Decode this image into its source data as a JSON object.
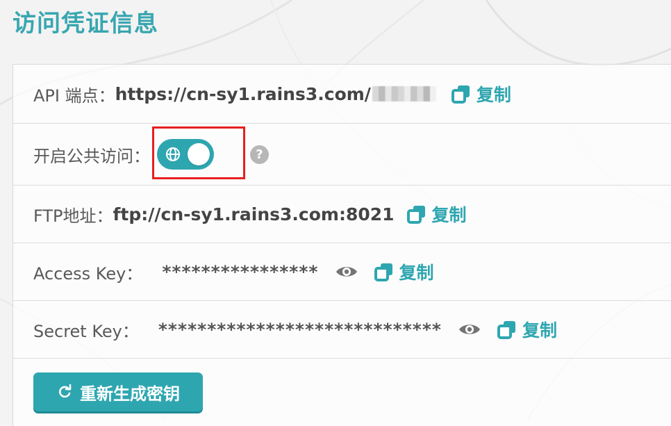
{
  "page": {
    "title": "访问凭证信息"
  },
  "api": {
    "label": "API 端点：",
    "value": "https://cn-sy1.rains3.com/",
    "copy_label": "复制"
  },
  "public_access": {
    "label": "开启公共访问："
  },
  "ftp": {
    "label": "FTP地址：",
    "value": "ftp://cn-sy1.rains3.com:8021",
    "copy_label": "复制"
  },
  "access_key": {
    "label": "Access Key：",
    "masked_value": "****************",
    "copy_label": "复制"
  },
  "secret_key": {
    "label": "Secret Key：",
    "masked_value": "*****************************",
    "copy_label": "复制"
  },
  "actions": {
    "regenerate_label": "重新生成密钥"
  },
  "icons": {
    "copy": "copy-icon",
    "eye": "eye-icon",
    "globe": "globe-icon",
    "help": "help-icon",
    "refresh": "refresh-icon"
  },
  "colors": {
    "accent": "#2ea6b0",
    "highlight": "#e81f1f"
  }
}
